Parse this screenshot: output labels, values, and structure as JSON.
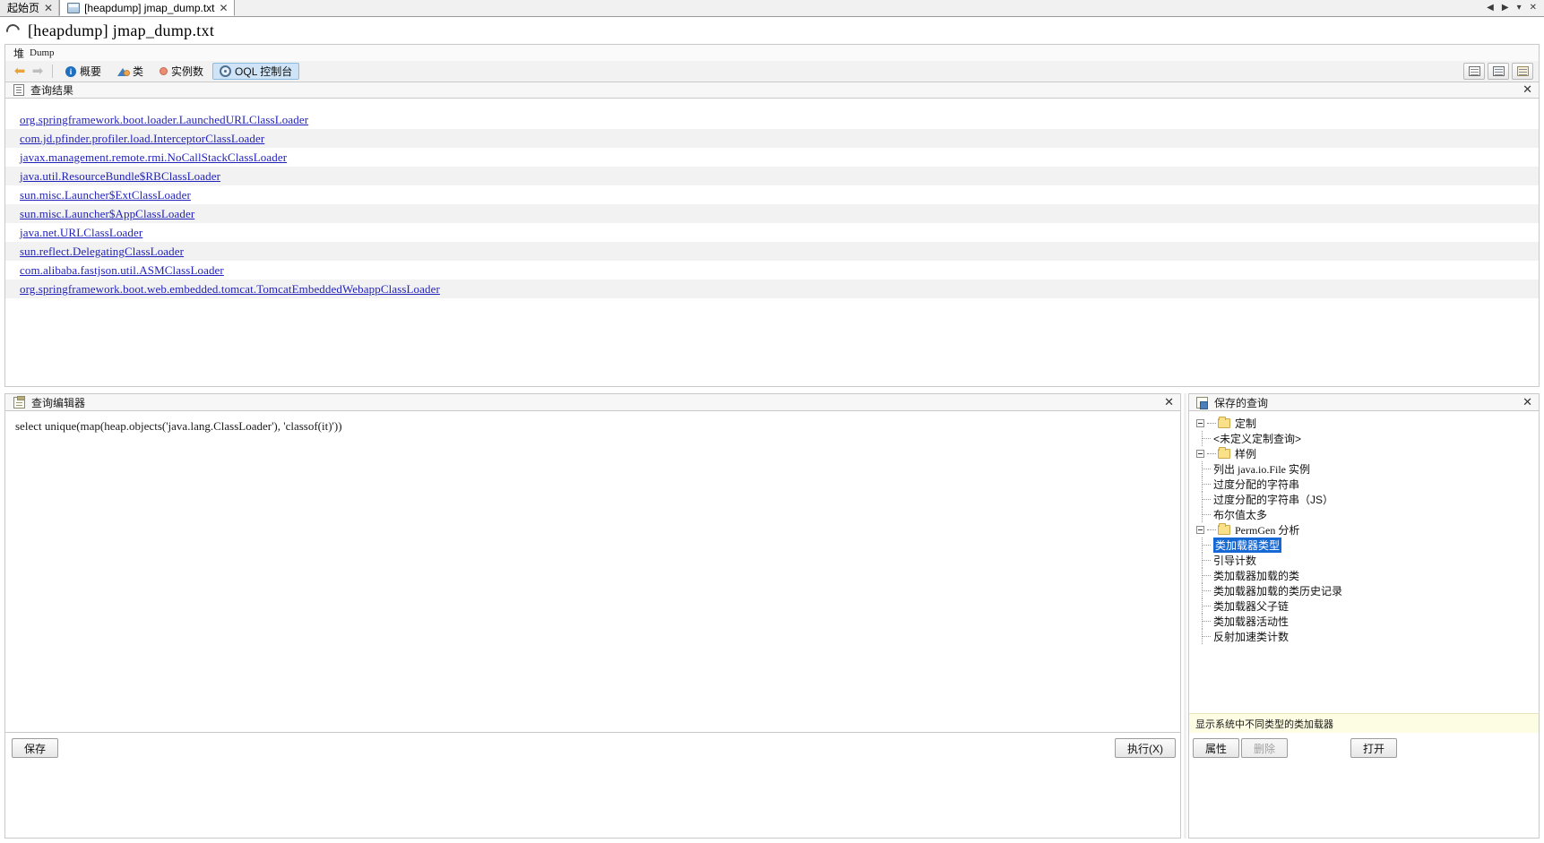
{
  "window": {
    "tabs": [
      {
        "label": "起始页",
        "icon": "",
        "active": false,
        "close": "✕"
      },
      {
        "label": "[heapdump] jmap_dump.txt",
        "icon": "heapdump-icon",
        "active": true,
        "close": "✕"
      }
    ],
    "right_controls": [
      "◀",
      "▶",
      "▾",
      "✕"
    ]
  },
  "document": {
    "title": "[heapdump] jmap_dump.txt",
    "loading_icon": "spinner-icon"
  },
  "heap_header": {
    "label": "堆",
    "sublabel": "Dump"
  },
  "view_toolbar": {
    "back_icon": "arrow-left-icon",
    "forward_icon": "arrow-right-icon",
    "buttons": [
      {
        "label": "概要",
        "icon": "info-icon",
        "selected": false
      },
      {
        "label": "类",
        "icon": "classes-icon",
        "selected": false
      },
      {
        "label": "实例数",
        "icon": "instances-icon",
        "selected": false
      },
      {
        "label": "OQL 控制台",
        "icon": "oql-icon",
        "selected": true
      }
    ],
    "right_buttons": [
      "list-view-icon",
      "snapshot-icon",
      "save-snapshot-icon"
    ]
  },
  "query_result": {
    "title": "查询结果",
    "icon": "document-icon",
    "close": "✕",
    "items": [
      "org.springframework.boot.loader.LaunchedURLClassLoader",
      "com.jd.pfinder.profiler.load.InterceptorClassLoader",
      "javax.management.remote.rmi.NoCallStackClassLoader",
      "java.util.ResourceBundle$RBClassLoader",
      "sun.misc.Launcher$ExtClassLoader",
      "sun.misc.Launcher$AppClassLoader",
      "java.net.URLClassLoader",
      "sun.reflect.DelegatingClassLoader",
      "com.alibaba.fastjson.util.ASMClassLoader",
      "org.springframework.boot.web.embedded.tomcat.TomcatEmbeddedWebappClassLoader"
    ]
  },
  "query_editor": {
    "title": "查询编辑器",
    "icon": "editor-icon",
    "close": "✕",
    "code": "select unique(map(heap.objects('java.lang.ClassLoader'), 'classof(it)'))",
    "save_label": "保存",
    "execute_label": "执行(X)"
  },
  "saved_queries": {
    "title": "保存的查询",
    "icon": "saved-queries-icon",
    "close": "✕",
    "tree": [
      {
        "level": 0,
        "type": "folder",
        "label": "定制",
        "expander": "−"
      },
      {
        "level": 1,
        "type": "leaf",
        "label": "<未定义定制查询>",
        "selected": false
      },
      {
        "level": 0,
        "type": "folder",
        "label": "样例",
        "expander": "−"
      },
      {
        "level": 1,
        "type": "leaf",
        "label": "列出 java.io.File 实例",
        "selected": false
      },
      {
        "level": 1,
        "type": "leaf",
        "label": "过度分配的字符串",
        "selected": false
      },
      {
        "level": 1,
        "type": "leaf",
        "label": "过度分配的字符串（JS）",
        "selected": false
      },
      {
        "level": 1,
        "type": "leaf",
        "label": "布尔值太多",
        "selected": false
      },
      {
        "level": 0,
        "type": "folder",
        "label": "PermGen 分析",
        "expander": "−"
      },
      {
        "level": 1,
        "type": "leaf",
        "label": "类加载器类型",
        "selected": true
      },
      {
        "level": 1,
        "type": "leaf",
        "label": "引导计数",
        "selected": false
      },
      {
        "level": 1,
        "type": "leaf",
        "label": "类加载器加载的类",
        "selected": false
      },
      {
        "level": 1,
        "type": "leaf",
        "label": "类加载器加载的类历史记录",
        "selected": false
      },
      {
        "level": 1,
        "type": "leaf",
        "label": "类加载器父子链",
        "selected": false
      },
      {
        "level": 1,
        "type": "leaf",
        "label": "类加载器活动性",
        "selected": false
      },
      {
        "level": 1,
        "type": "leaf",
        "label": "反射加速类计数",
        "selected": false
      }
    ],
    "tip": "显示系统中不同类型的类加载器",
    "buttons": [
      {
        "label": "属性",
        "disabled": false
      },
      {
        "label": "删除",
        "disabled": true
      },
      {
        "label": "打开",
        "disabled": false
      }
    ]
  },
  "colors": {
    "selection_blue": "#1669d4",
    "link_blue": "#2222bb",
    "toolbar_selected": "#cfe5f7",
    "tip_background": "#fdfde3",
    "folder_yellow": "#fbe08a"
  }
}
